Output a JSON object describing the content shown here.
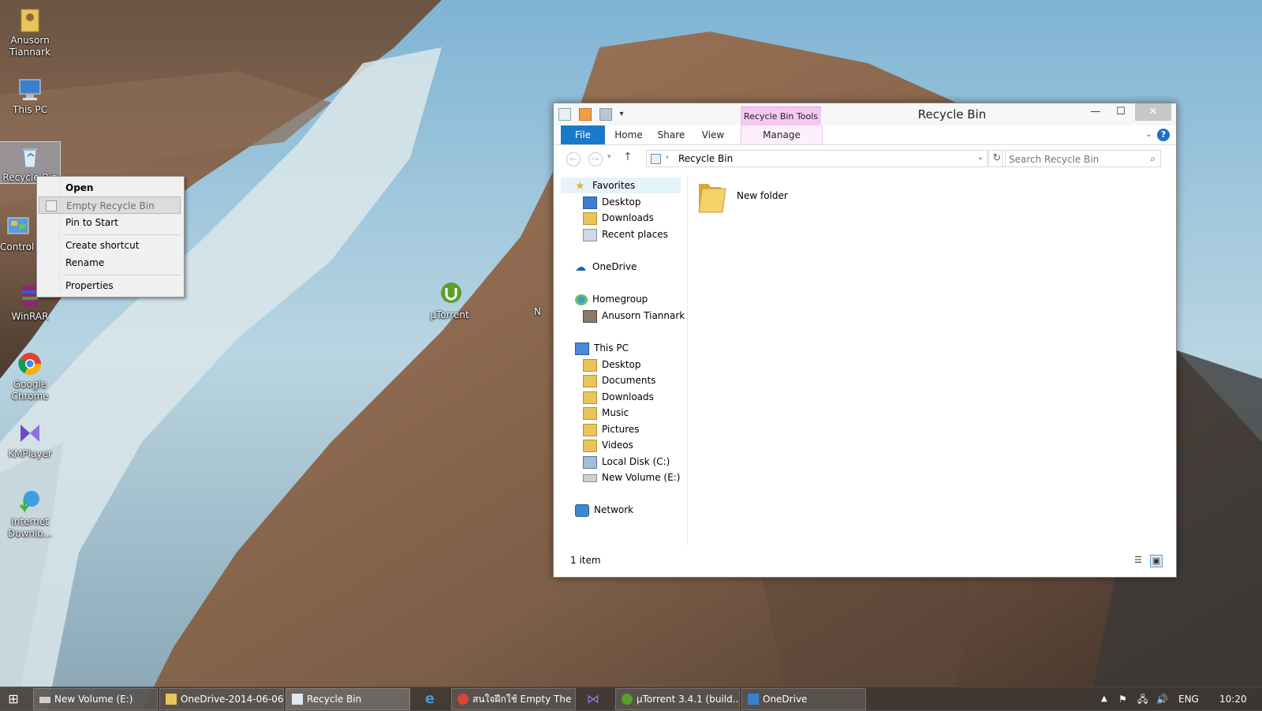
{
  "desktop": {
    "icons": [
      {
        "label": "Anusorn Tiannark",
        "icon": "user-folder-icon"
      },
      {
        "label": "This PC",
        "icon": "computer-icon"
      },
      {
        "label": "Recycle Bin",
        "icon": "recycle-bin-icon"
      },
      {
        "label": "Control Panel",
        "icon": "control-panel-icon"
      },
      {
        "label": "WinRAR",
        "icon": "winrar-icon"
      },
      {
        "label": "Google Chrome",
        "icon": "chrome-icon"
      },
      {
        "label": "KMPlayer",
        "icon": "kmplayer-icon"
      },
      {
        "label": "Internet Downlo...",
        "icon": "idm-icon"
      },
      {
        "label": "µTorrent",
        "icon": "utorrent-icon"
      },
      {
        "label": "N",
        "icon": "partial-icon"
      }
    ]
  },
  "context_menu": {
    "items": [
      "Open",
      "Empty Recycle Bin",
      "Pin to Start",
      "Create shortcut",
      "Rename",
      "Properties"
    ]
  },
  "explorer": {
    "title": "Recycle Bin",
    "contextual_tab": "Recycle Bin Tools",
    "ribbon_tabs": [
      "File",
      "Home",
      "Share",
      "View",
      "Manage"
    ],
    "address": "Recycle Bin",
    "search_placeholder": "Search Recycle Bin",
    "nav": {
      "favorites": "Favorites",
      "favorites_items": [
        "Desktop",
        "Downloads",
        "Recent places"
      ],
      "onedrive": "OneDrive",
      "homegroup": "Homegroup",
      "homegroup_items": [
        "Anusorn Tiannark"
      ],
      "thispc": "This PC",
      "thispc_items": [
        "Desktop",
        "Documents",
        "Downloads",
        "Music",
        "Pictures",
        "Videos",
        "Local Disk (C:)",
        "New Volume (E:)"
      ],
      "network": "Network"
    },
    "files": [
      {
        "name": "New folder",
        "icon": "folder-icon"
      }
    ],
    "status": "1 item"
  },
  "taskbar": {
    "buttons": [
      "New Volume (E:)",
      "OneDrive-2014-06-06",
      "Recycle Bin",
      "สนใจฝึกใช้ Empty The R...",
      "µTorrent 3.4.1  (build...",
      "OneDrive"
    ],
    "language": "ENG",
    "clock": "10:20"
  },
  "colors": {
    "accent": "#1979ca",
    "contextual_tab": "#f5c8f0"
  }
}
